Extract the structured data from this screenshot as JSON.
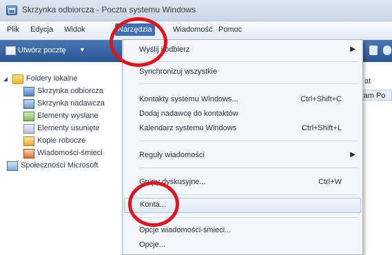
{
  "window": {
    "title": "Skrzynka odbiorcza - Poczta systemu Windows"
  },
  "menubar": {
    "items": [
      "Plik",
      "Edycja",
      "Widok",
      "Narzędzia",
      "Wiadomość",
      "Pomoc"
    ],
    "active": "Narzędzia"
  },
  "toolbar": {
    "new_mail_label": "Utwórz pocztę"
  },
  "folders": {
    "root": "Foldery lokalne",
    "items": [
      "Skrzynka odbiorcza",
      "Skrzynka nadawcza",
      "Elementy wysłane",
      "Elementy usunięte",
      "Kopie robocze",
      "Wiadomości-śmieci"
    ],
    "communities": "Społeczności Microsoft"
  },
  "right_pane": {
    "column_header": "at",
    "selected_cell": "ram Po"
  },
  "tools_menu": {
    "send_receive": "Wyślij i odbierz",
    "synchronize_all": "Synchronizuj wszystkie",
    "contacts": "Kontakty systemu Windows...",
    "contacts_shortcut": "Ctrl+Shift+C",
    "add_sender": "Dodaj nadawcę do kontaktów",
    "calendar": "Kalendarz systemu Windows",
    "calendar_shortcut": "Ctrl+Shift+L",
    "rules": "Reguły wiadomości",
    "newsgroups": "Grupy dyskusyjne...",
    "newsgroups_shortcut": "Ctrl+W",
    "accounts": "Konta...",
    "junk_options": "Opcje wiadomości-śmieci...",
    "options": "Opcje..."
  },
  "colors": {
    "highlight_circle": "#e0141c",
    "menu_active": "#3d6fb3",
    "toolbar": "#2a5592"
  }
}
